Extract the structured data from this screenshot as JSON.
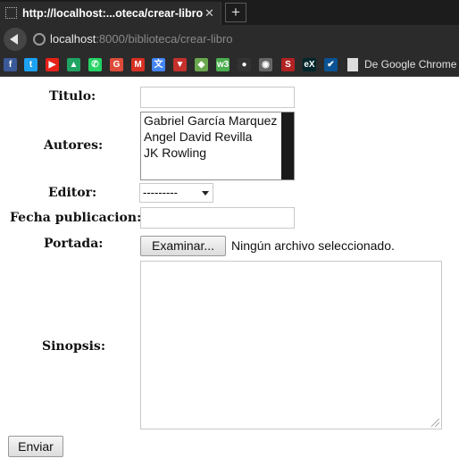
{
  "browser": {
    "tab_title": "http://localhost:...oteca/crear-libro",
    "tab_close": "✕",
    "new_tab": "+",
    "url_host": "localhost",
    "url_rest": ":8000/biblioteca/crear-libro",
    "bookmarks": [
      {
        "icon": "facebook-icon",
        "glyph": "f",
        "color": "#3b5998"
      },
      {
        "icon": "twitter-icon",
        "glyph": "t",
        "color": "#1da1f2"
      },
      {
        "icon": "youtube-icon",
        "glyph": "▶",
        "color": "#e62117"
      },
      {
        "icon": "google-drive-icon",
        "glyph": "▲",
        "color": "#1fa463"
      },
      {
        "icon": "whatsapp-icon",
        "glyph": "✆",
        "color": "#25d366"
      },
      {
        "icon": "google-plus-icon",
        "glyph": "G",
        "color": "#dd4b39"
      },
      {
        "icon": "gmail-icon",
        "glyph": "M",
        "color": "#d93025"
      },
      {
        "icon": "google-translate-icon",
        "glyph": "文",
        "color": "#4285f4"
      },
      {
        "icon": "bookmark-red-icon",
        "glyph": "▼",
        "color": "#c4302b"
      },
      {
        "icon": "game-icon",
        "glyph": "◆",
        "color": "#6aa84f"
      },
      {
        "icon": "w3-icon",
        "glyph": "w3",
        "color": "#4caf50"
      },
      {
        "icon": "github-icon",
        "glyph": "●",
        "color": "#333333"
      },
      {
        "icon": "avatar-icon",
        "glyph": "◉",
        "color": "#666666"
      },
      {
        "icon": "s-icon",
        "glyph": "S",
        "color": "#b22222"
      },
      {
        "icon": "edx-icon",
        "glyph": "eX",
        "color": "#02262b"
      },
      {
        "icon": "check-icon",
        "glyph": "✔",
        "color": "#0b5394"
      }
    ],
    "bookmark_label": "De Google Chrome"
  },
  "form": {
    "titulo_label": "Titulo:",
    "autores_label": "Autores:",
    "autores_options": [
      "Gabriel García Marquez",
      "Angel David Revilla",
      "JK Rowling"
    ],
    "editor_label": "Editor:",
    "editor_selected": "---------",
    "fecha_label": "Fecha publicacion:",
    "portada_label": "Portada:",
    "examinar_label": "Examinar...",
    "file_status": "Ningún archivo seleccionado.",
    "sinopsis_label": "Sinopsis:",
    "enviar_label": "Enviar"
  }
}
